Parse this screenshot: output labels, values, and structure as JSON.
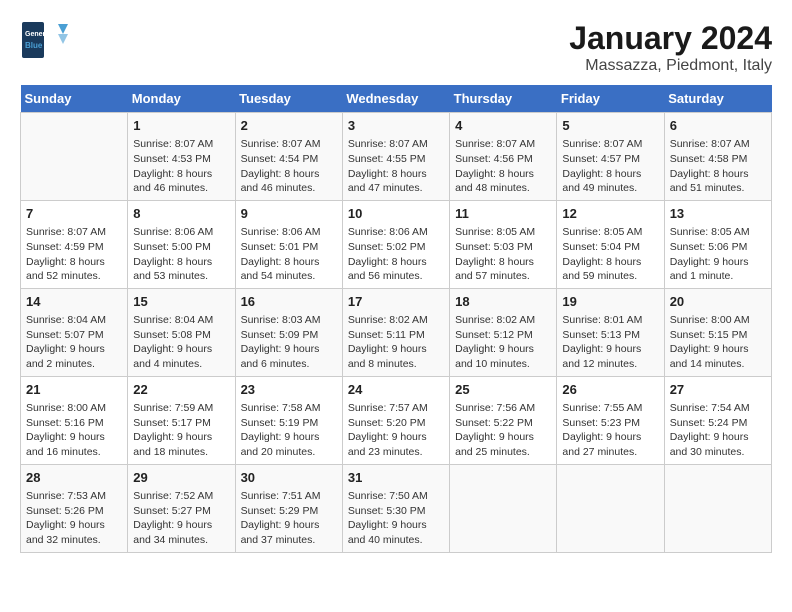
{
  "header": {
    "logo_line1": "General",
    "logo_line2": "Blue",
    "title": "January 2024",
    "subtitle": "Massazza, Piedmont, Italy"
  },
  "days_of_week": [
    "Sunday",
    "Monday",
    "Tuesday",
    "Wednesday",
    "Thursday",
    "Friday",
    "Saturday"
  ],
  "weeks": [
    [
      {
        "day": "",
        "info": ""
      },
      {
        "day": "1",
        "info": "Sunrise: 8:07 AM\nSunset: 4:53 PM\nDaylight: 8 hours\nand 46 minutes."
      },
      {
        "day": "2",
        "info": "Sunrise: 8:07 AM\nSunset: 4:54 PM\nDaylight: 8 hours\nand 46 minutes."
      },
      {
        "day": "3",
        "info": "Sunrise: 8:07 AM\nSunset: 4:55 PM\nDaylight: 8 hours\nand 47 minutes."
      },
      {
        "day": "4",
        "info": "Sunrise: 8:07 AM\nSunset: 4:56 PM\nDaylight: 8 hours\nand 48 minutes."
      },
      {
        "day": "5",
        "info": "Sunrise: 8:07 AM\nSunset: 4:57 PM\nDaylight: 8 hours\nand 49 minutes."
      },
      {
        "day": "6",
        "info": "Sunrise: 8:07 AM\nSunset: 4:58 PM\nDaylight: 8 hours\nand 51 minutes."
      }
    ],
    [
      {
        "day": "7",
        "info": "Sunrise: 8:07 AM\nSunset: 4:59 PM\nDaylight: 8 hours\nand 52 minutes."
      },
      {
        "day": "8",
        "info": "Sunrise: 8:06 AM\nSunset: 5:00 PM\nDaylight: 8 hours\nand 53 minutes."
      },
      {
        "day": "9",
        "info": "Sunrise: 8:06 AM\nSunset: 5:01 PM\nDaylight: 8 hours\nand 54 minutes."
      },
      {
        "day": "10",
        "info": "Sunrise: 8:06 AM\nSunset: 5:02 PM\nDaylight: 8 hours\nand 56 minutes."
      },
      {
        "day": "11",
        "info": "Sunrise: 8:05 AM\nSunset: 5:03 PM\nDaylight: 8 hours\nand 57 minutes."
      },
      {
        "day": "12",
        "info": "Sunrise: 8:05 AM\nSunset: 5:04 PM\nDaylight: 8 hours\nand 59 minutes."
      },
      {
        "day": "13",
        "info": "Sunrise: 8:05 AM\nSunset: 5:06 PM\nDaylight: 9 hours\nand 1 minute."
      }
    ],
    [
      {
        "day": "14",
        "info": "Sunrise: 8:04 AM\nSunset: 5:07 PM\nDaylight: 9 hours\nand 2 minutes."
      },
      {
        "day": "15",
        "info": "Sunrise: 8:04 AM\nSunset: 5:08 PM\nDaylight: 9 hours\nand 4 minutes."
      },
      {
        "day": "16",
        "info": "Sunrise: 8:03 AM\nSunset: 5:09 PM\nDaylight: 9 hours\nand 6 minutes."
      },
      {
        "day": "17",
        "info": "Sunrise: 8:02 AM\nSunset: 5:11 PM\nDaylight: 9 hours\nand 8 minutes."
      },
      {
        "day": "18",
        "info": "Sunrise: 8:02 AM\nSunset: 5:12 PM\nDaylight: 9 hours\nand 10 minutes."
      },
      {
        "day": "19",
        "info": "Sunrise: 8:01 AM\nSunset: 5:13 PM\nDaylight: 9 hours\nand 12 minutes."
      },
      {
        "day": "20",
        "info": "Sunrise: 8:00 AM\nSunset: 5:15 PM\nDaylight: 9 hours\nand 14 minutes."
      }
    ],
    [
      {
        "day": "21",
        "info": "Sunrise: 8:00 AM\nSunset: 5:16 PM\nDaylight: 9 hours\nand 16 minutes."
      },
      {
        "day": "22",
        "info": "Sunrise: 7:59 AM\nSunset: 5:17 PM\nDaylight: 9 hours\nand 18 minutes."
      },
      {
        "day": "23",
        "info": "Sunrise: 7:58 AM\nSunset: 5:19 PM\nDaylight: 9 hours\nand 20 minutes."
      },
      {
        "day": "24",
        "info": "Sunrise: 7:57 AM\nSunset: 5:20 PM\nDaylight: 9 hours\nand 23 minutes."
      },
      {
        "day": "25",
        "info": "Sunrise: 7:56 AM\nSunset: 5:22 PM\nDaylight: 9 hours\nand 25 minutes."
      },
      {
        "day": "26",
        "info": "Sunrise: 7:55 AM\nSunset: 5:23 PM\nDaylight: 9 hours\nand 27 minutes."
      },
      {
        "day": "27",
        "info": "Sunrise: 7:54 AM\nSunset: 5:24 PM\nDaylight: 9 hours\nand 30 minutes."
      }
    ],
    [
      {
        "day": "28",
        "info": "Sunrise: 7:53 AM\nSunset: 5:26 PM\nDaylight: 9 hours\nand 32 minutes."
      },
      {
        "day": "29",
        "info": "Sunrise: 7:52 AM\nSunset: 5:27 PM\nDaylight: 9 hours\nand 34 minutes."
      },
      {
        "day": "30",
        "info": "Sunrise: 7:51 AM\nSunset: 5:29 PM\nDaylight: 9 hours\nand 37 minutes."
      },
      {
        "day": "31",
        "info": "Sunrise: 7:50 AM\nSunset: 5:30 PM\nDaylight: 9 hours\nand 40 minutes."
      },
      {
        "day": "",
        "info": ""
      },
      {
        "day": "",
        "info": ""
      },
      {
        "day": "",
        "info": ""
      }
    ]
  ]
}
